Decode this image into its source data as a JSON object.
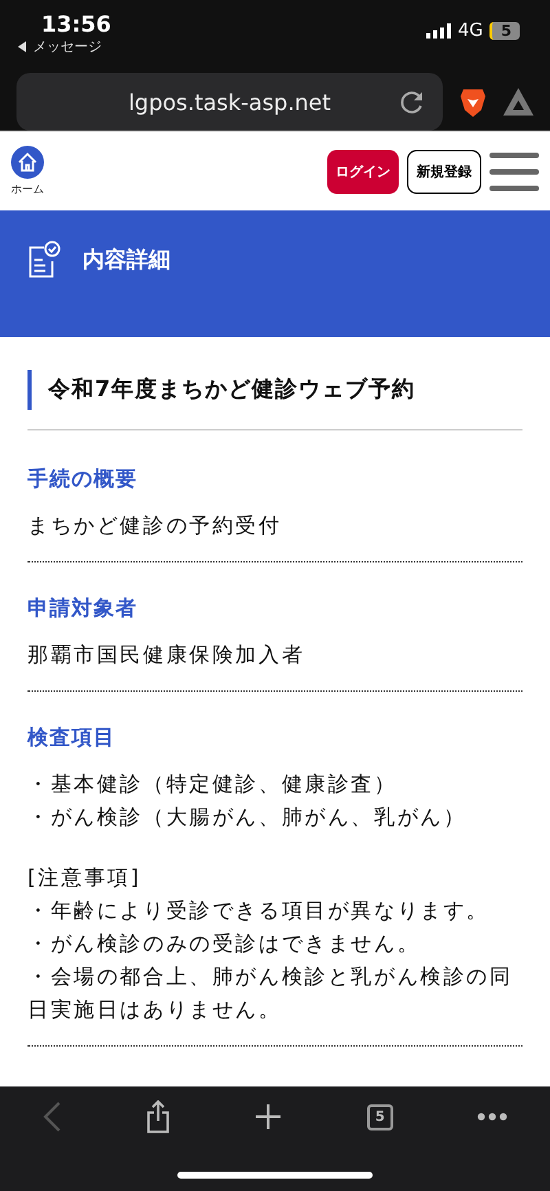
{
  "status_bar": {
    "time": "13:56",
    "back_label": "メッセージ",
    "network": "4G",
    "battery": "5"
  },
  "browser": {
    "url": "lgpos.task-asp.net"
  },
  "nav": {
    "home_label": "ホーム",
    "login": "ログイン",
    "register": "新規登録"
  },
  "banner": {
    "title": "内容詳細"
  },
  "page_title": "令和7年度まちかど健診ウェブ予約",
  "sections": [
    {
      "heading": "手続の概要",
      "paragraphs": [
        [
          "まちかど健診の予約受付"
        ]
      ]
    },
    {
      "heading": "申請対象者",
      "paragraphs": [
        [
          "那覇市国民健康保険加入者"
        ]
      ]
    },
    {
      "heading": "検査項目",
      "paragraphs": [
        [
          "・基本健診（特定健診、健康診査）",
          "・がん検診（大腸がん、肺がん、乳がん）"
        ],
        [
          "[注意事項]",
          "・年齢により受診できる項目が異なります。",
          "・がん検診のみの受診はできません。",
          "・会場の都合上、肺がん検診と乳がん検診の同日実施日はありません。"
        ]
      ]
    }
  ],
  "toolbar": {
    "back_disabled": true,
    "tab_count": "5"
  }
}
